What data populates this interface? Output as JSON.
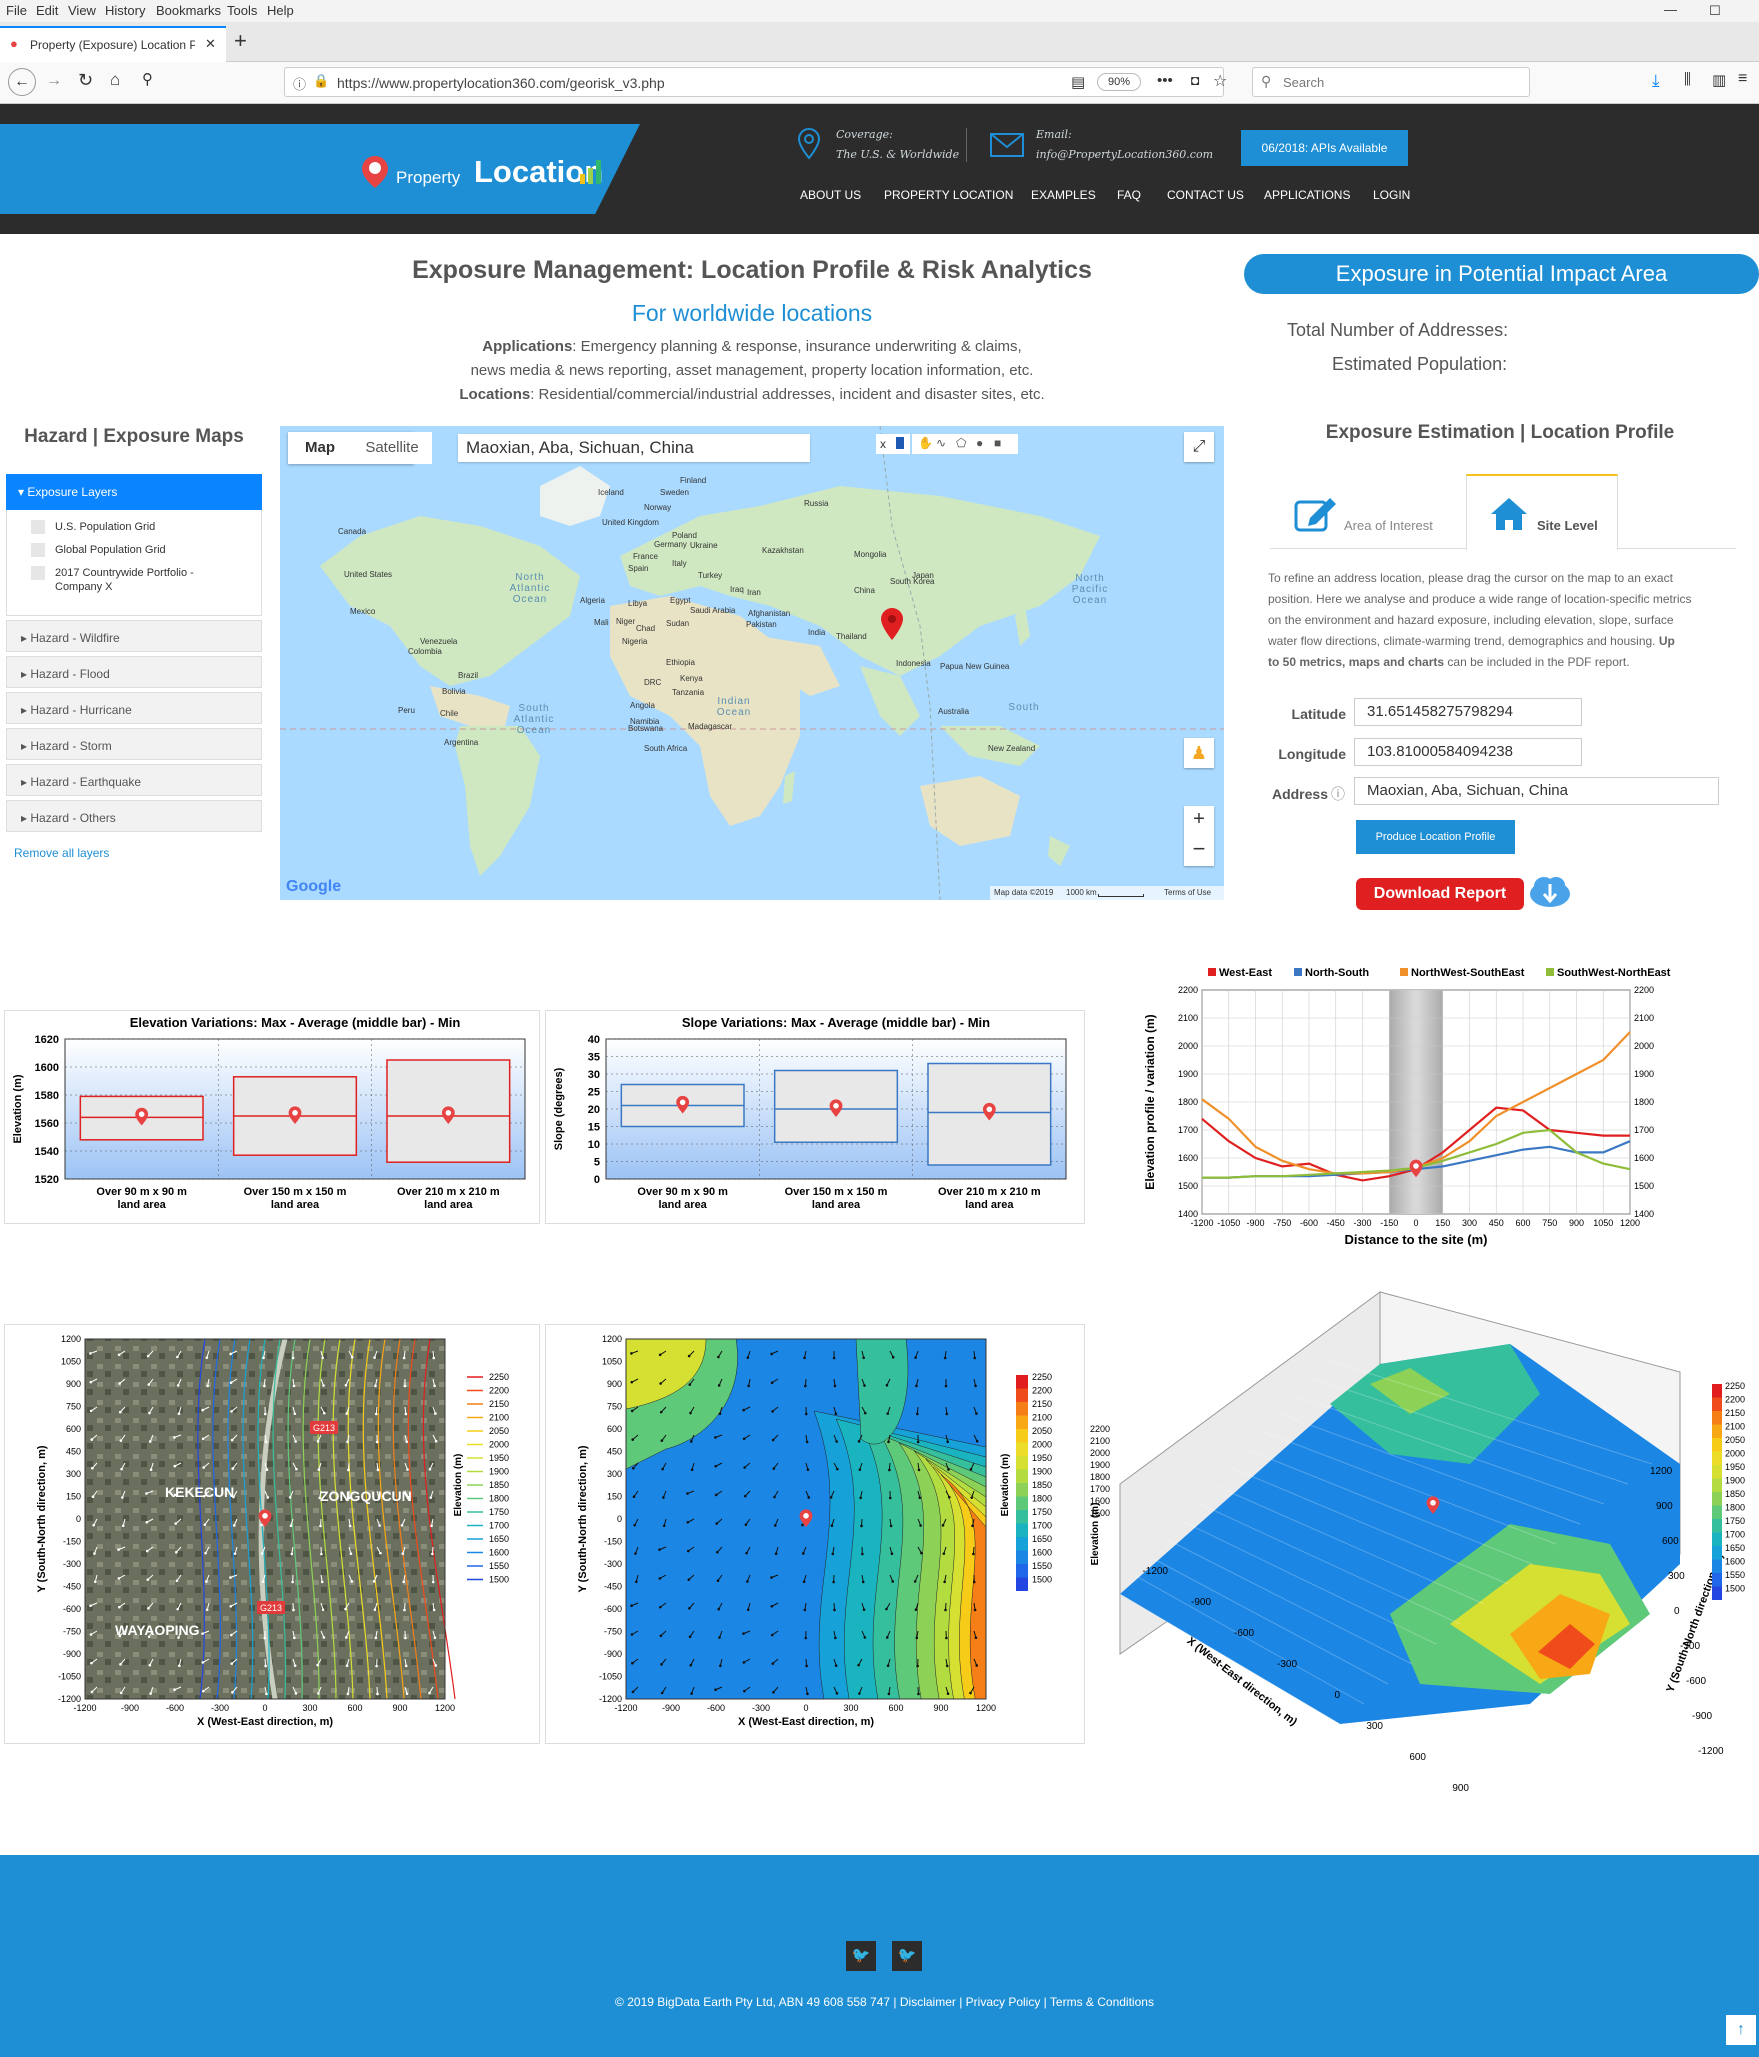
{
  "browser": {
    "menu": [
      "File",
      "Edit",
      "View",
      "History",
      "Bookmarks",
      "Tools",
      "Help"
    ],
    "tab_title": "Property (Exposure) Location Pr",
    "url": "https://www.propertylocation360.com/georisk_v3.php",
    "zoom": "90%",
    "search_placeholder": "Search"
  },
  "header": {
    "logo_text_a": "Property",
    "logo_text_b": "Location",
    "coverage_label": "Coverage:",
    "coverage_value": "The U.S. & Worldwide",
    "email_label": "Email:",
    "email_value": "info@PropertyLocation360.com",
    "api_button": "06/2018: APIs Available",
    "nav": [
      "ABOUT US",
      "PROPERTY LOCATION",
      "EXAMPLES",
      "FAQ",
      "CONTACT US",
      "APPLICATIONS",
      "LOGIN"
    ]
  },
  "intro": {
    "title": "Exposure Management: Location Profile & Risk Analytics",
    "subtitle": "For worldwide locations",
    "app_label": "Applications",
    "app_text": ": Emergency planning & response, insurance underwriting & claims,",
    "app_text2": "news media & news reporting, asset management, property location information, etc.",
    "loc_label": "Locations",
    "loc_text": ": Residential/commercial/industrial addresses, incident and disaster sites, etc."
  },
  "exposure": {
    "pill": "Exposure in Potential Impact Area",
    "total_label": "Total Number of Addresses:",
    "pop_label": "Estimated Population:",
    "section_title": "Exposure Estimation | Location Profile",
    "tab_area": "Area of Interest",
    "tab_site": "Site Level",
    "desc_1": "To refine an address location, please drag the cursor on the map to an exact",
    "desc_2": "position. Here we analyse and produce a wide range of location-specific metrics",
    "desc_3": "on the environment and hazard exposure, including elevation, slope, surface",
    "desc_4a": "water flow directions, climate-warming trend, demographics and housing.",
    "desc_4b": "Up",
    "desc_5a": "to 50 metrics, maps and charts",
    "desc_5b": "can be included in the PDF report.",
    "lat_label": "Latitude",
    "lat_value": "31.651458275798294",
    "lon_label": "Longitude",
    "lon_value": "103.81000584094238",
    "addr_label": "Address",
    "addr_value": "Maoxian, Aba, Sichuan, China",
    "produce_button": "Produce Location Profile",
    "download_button": "Download Report"
  },
  "sidebar": {
    "title": "Hazard | Exposure Maps",
    "active": "Exposure Layers",
    "layers": [
      "U.S. Population Grid",
      "Global Population Grid",
      "2017 Countrywide Portfolio -",
      "Company X"
    ],
    "hazards": [
      "Hazard - Wildfire",
      "Hazard - Flood",
      "Hazard - Hurricane",
      "Hazard - Storm",
      "Hazard - Earthquake",
      "Hazard - Others"
    ],
    "remove": "Remove all layers"
  },
  "map": {
    "tab_map": "Map",
    "tab_sat": "Satellite",
    "search_value": "Maoxian, Aba, Sichuan, China",
    "attribution": "Map data ©2019",
    "scale": "1000 km",
    "terms": "Terms of Use",
    "google": "Google",
    "labels": [
      "Finland",
      "Sweden",
      "Norway",
      "Iceland",
      "United Kingdom",
      "Poland",
      "Germany",
      "Ukraine",
      "France",
      "Italy",
      "Spain",
      "Turkey",
      "Iraq",
      "Iran",
      "Kazakhstan",
      "Mongolia",
      "Afghanistan",
      "Pakistan",
      "India",
      "China",
      "Thailand",
      "Japan",
      "South Korea",
      "Russia",
      "Canada",
      "United States",
      "Mexico",
      "Venezuela",
      "Colombia",
      "Peru",
      "Brazil",
      "Bolivia",
      "Chile",
      "Argentina",
      "Algeria",
      "Libya",
      "Egypt",
      "Mali",
      "Niger",
      "Chad",
      "Sudan",
      "Nigeria",
      "Ethiopia",
      "DRC",
      "Kenya",
      "Tanzania",
      "Angola",
      "Namibia",
      "Botswana",
      "South Africa",
      "Madagascar",
      "Saudi Arabia",
      "Indonesia",
      "Papua New Guinea",
      "Australia",
      "New Zealand",
      "North Atlantic Ocean",
      "North Pacific Ocean",
      "South Atlantic Ocean",
      "Indian Ocean",
      "South"
    ]
  },
  "charts": {
    "elev_title": "Elevation Variations: Max - Average (middle bar) - Min",
    "elev_ylabel": "Elevation (m)",
    "slope_title": "Slope Variations: Max - Average (middle bar) - Min",
    "slope_ylabel": "Slope (degrees)",
    "areas": [
      "Over 90 m x 90 m",
      "Over 150 m x 150 m",
      "Over 210 m x 210 m"
    ],
    "area_suffix": "land area",
    "profile_legend": [
      "West-East",
      "North-South",
      "NorthWest-SouthEast",
      "SouthWest-NorthEast"
    ],
    "profile_xlabel": "Distance to the site (m)",
    "profile_ylabel": "Elevation profile / variation (m)",
    "contour_xlabel": "X (West-East direction, m)",
    "contour_ylabel": "Y (South-North direction, m)",
    "contour_legend_label": "Elevation (m)",
    "sat_places": [
      "KEKECUN",
      "ZONGQUCUN",
      "WAYAOPING",
      "G213",
      "G213"
    ],
    "surface_zlabel": "Elevation (m)",
    "surface_xlabel": "X (West-East direction, m)",
    "surface_ylabel": "Y (South-North direction, m)"
  },
  "chart_data": [
    {
      "type": "bar",
      "title": "Elevation Variations: Max - Average (middle bar) - Min",
      "ylabel": "Elevation (m)",
      "categories": [
        "Over 90 m x 90 m land area",
        "Over 150 m x 150 m land area",
        "Over 210 m x 210 m land area"
      ],
      "max": [
        1579,
        1593,
        1605
      ],
      "avg": [
        1564,
        1565,
        1565
      ],
      "min": [
        1548,
        1537,
        1532
      ],
      "ylim": [
        1520,
        1620
      ],
      "yticks": [
        1520,
        1540,
        1560,
        1580,
        1600,
        1620
      ]
    },
    {
      "type": "bar",
      "title": "Slope Variations: Max - Average (middle bar) - Min",
      "ylabel": "Slope (degrees)",
      "categories": [
        "Over 90 m x 90 m land area",
        "Over 150 m x 150 m land area",
        "Over 210 m x 210 m land area"
      ],
      "max": [
        27,
        31,
        33
      ],
      "avg": [
        21,
        20,
        19
      ],
      "min": [
        15,
        10.5,
        4
      ],
      "ylim": [
        0,
        40
      ],
      "yticks": [
        0,
        5,
        10,
        15,
        20,
        25,
        30,
        35,
        40
      ]
    },
    {
      "type": "line",
      "xlabel": "Distance to the site (m)",
      "ylabel": "Elevation profile / variation (m)",
      "x": [
        -1200,
        -1050,
        -900,
        -750,
        -600,
        -450,
        -300,
        -150,
        0,
        150,
        300,
        450,
        600,
        750,
        900,
        1050,
        1200
      ],
      "ylim": [
        1400,
        2200
      ],
      "series": [
        {
          "name": "West-East",
          "color": "#e02020",
          "values": [
            1740,
            1660,
            1600,
            1570,
            1580,
            1540,
            1520,
            1535,
            1560,
            1620,
            1700,
            1780,
            1770,
            1700,
            1690,
            1680,
            1680
          ]
        },
        {
          "name": "North-South",
          "color": "#3b78c4",
          "values": [
            1530,
            1530,
            1535,
            1535,
            1535,
            1540,
            1545,
            1550,
            1560,
            1570,
            1590,
            1610,
            1630,
            1640,
            1620,
            1620,
            1660
          ]
        },
        {
          "name": "NorthWest-SouthEast",
          "color": "#f0902a",
          "values": [
            1810,
            1740,
            1640,
            1590,
            1560,
            1545,
            1545,
            1550,
            1565,
            1600,
            1660,
            1750,
            1800,
            1850,
            1900,
            1950,
            2050
          ]
        },
        {
          "name": "SouthWest-NorthEast",
          "color": "#8fbd3a",
          "values": [
            1530,
            1530,
            1535,
            1535,
            1540,
            1545,
            1550,
            1555,
            1565,
            1590,
            1620,
            1650,
            1690,
            1700,
            1620,
            1580,
            1560
          ]
        }
      ]
    }
  ],
  "contour_levels": [
    "2250",
    "2200",
    "2150",
    "2100",
    "2050",
    "2000",
    "1950",
    "1900",
    "1850",
    "1800",
    "1750",
    "1700",
    "1650",
    "1600",
    "1550",
    "1500"
  ],
  "xy_ticks": [
    "-1200",
    "-900",
    "-600",
    "-300",
    "0",
    "300",
    "600",
    "900",
    "1200"
  ],
  "y_ticks": [
    "1200",
    "1050",
    "900",
    "750",
    "600",
    "450",
    "300",
    "150",
    "0",
    "-150",
    "-300",
    "-450",
    "-600",
    "-750",
    "-900",
    "-1050",
    "-1200"
  ],
  "profile_x_ticks": [
    "-1200",
    "-1050",
    "-900",
    "-750",
    "-600",
    "-450",
    "-300",
    "-150",
    "0",
    "150",
    "300",
    "450",
    "600",
    "750",
    "900",
    "1050",
    "1200"
  ],
  "profile_y_ticks": [
    "2200",
    "2100",
    "2000",
    "1900",
    "1800",
    "1700",
    "1600",
    "1500",
    "1400"
  ],
  "surface_z_ticks": [
    "2200",
    "2100",
    "2000",
    "1900",
    "1800",
    "1700",
    "1600",
    "1500"
  ],
  "surface_x_ticks": [
    "-1200",
    "-900",
    "-600",
    "-300",
    "0",
    "300",
    "600",
    "900"
  ],
  "surface_y_ticks": [
    "1200",
    "900",
    "600",
    "300",
    "0",
    "-300",
    "-600",
    "-900",
    "-1200"
  ],
  "footer": {
    "copyright": "© 2019 BigData Earth Pty Ltd, ABN 49 608 558 747 | Disclaimer | Privacy Policy | Terms & Conditions"
  },
  "colors": {
    "brand": "#1e8fd4",
    "header_bg": "#2c2c2c",
    "download": "#e02020",
    "marker": "#e84343"
  }
}
